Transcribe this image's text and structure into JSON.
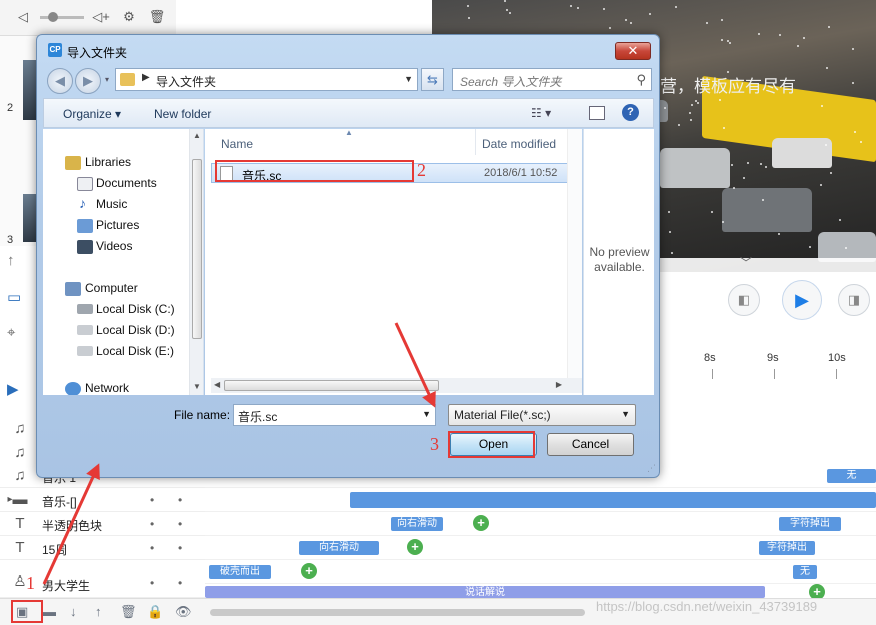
{
  "app": {
    "subtitle": "营，模板应有尽有",
    "timeline_ticks": [
      "8s",
      "9s",
      "10s"
    ],
    "layers": [
      {
        "icon": "audio-icon",
        "name": "音乐 1"
      },
      {
        "icon": "folder-icon",
        "name": "音乐-[]"
      },
      {
        "icon": "text-icon",
        "name": "半透明色块"
      },
      {
        "icon": "text-icon",
        "name": "15周"
      },
      {
        "icon": "person-icon",
        "name": "男大学生"
      }
    ],
    "clips": {
      "top_right": "无",
      "row_text1_a": "向右滑动",
      "row_text1_b": "字符掉出",
      "row_text2_a": "向右滑动",
      "row_text2_b": "字符掉出",
      "row_person_a": "破壳而出",
      "row_person_b": "无",
      "row_bottom": "说话解说"
    },
    "watermark": "https://blog.csdn.net/weixin_43739189",
    "thumb_numbers": [
      "2",
      "3"
    ]
  },
  "dialog": {
    "title": "导入文件夹",
    "address_path": "导入文件夹",
    "search_placeholder": "Search 导入文件夹",
    "organize_label": "Organize ▾",
    "new_folder_label": "New folder",
    "nav_items": {
      "libraries": "Libraries",
      "documents": "Documents",
      "music": "Music",
      "pictures": "Pictures",
      "videos": "Videos",
      "computer": "Computer",
      "disk_c": "Local Disk (C:)",
      "disk_d": "Local Disk (D:)",
      "disk_e": "Local Disk (E:)",
      "network": "Network"
    },
    "columns": {
      "name": "Name",
      "date": "Date modified"
    },
    "file": {
      "name": "音乐.sc",
      "date": "2018/6/1 10:52"
    },
    "no_preview_line1": "No preview",
    "no_preview_line2": "available.",
    "file_name_label": "File name:",
    "file_name_value": "音乐.sc",
    "file_type_value": "Material File(*.sc;)",
    "open_label": "Open",
    "cancel_label": "Cancel"
  },
  "annotations": [
    "1",
    "2",
    "3"
  ],
  "colors": {
    "annotation": "#e53935",
    "clip_blue": "#5a97e0",
    "accent": "#1e7ee6"
  }
}
